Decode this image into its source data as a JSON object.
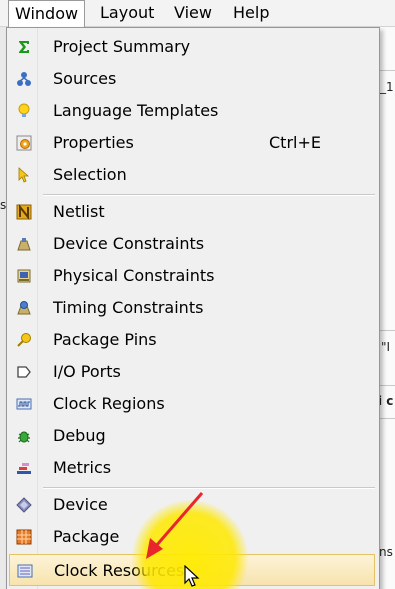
{
  "menubar": {
    "items": [
      {
        "label": "Window",
        "active": true
      },
      {
        "label": "Layout"
      },
      {
        "label": "View"
      },
      {
        "label": "Help"
      }
    ]
  },
  "background": {
    "frag1": "_1",
    "frag2": "s",
    "frag3": "\"I",
    "frag4": "i c",
    "frag5": "ns"
  },
  "menu": {
    "items": [
      {
        "label": "Project Summary",
        "icon": "sigma-icon"
      },
      {
        "label": "Sources",
        "icon": "sources-icon"
      },
      {
        "label": "Language Templates",
        "icon": "lightbulb-icon"
      },
      {
        "label": "Properties",
        "icon": "properties-icon",
        "shortcut": "Ctrl+E"
      },
      {
        "label": "Selection",
        "icon": "selection-cursor-icon"
      },
      {
        "label": "Netlist",
        "icon": "netlist-icon"
      },
      {
        "label": "Device Constraints",
        "icon": "device-constraints-icon"
      },
      {
        "label": "Physical Constraints",
        "icon": "physical-constraints-icon"
      },
      {
        "label": "Timing Constraints",
        "icon": "timing-constraints-icon"
      },
      {
        "label": "Package Pins",
        "icon": "package-pins-icon"
      },
      {
        "label": "I/O Ports",
        "icon": "io-ports-icon"
      },
      {
        "label": "Clock Regions",
        "icon": "clock-regions-icon"
      },
      {
        "label": "Debug",
        "icon": "debug-bug-icon"
      },
      {
        "label": "Metrics",
        "icon": "metrics-icon"
      },
      {
        "label": "Device",
        "icon": "device-icon"
      },
      {
        "label": "Package",
        "icon": "package-icon"
      },
      {
        "label": "Clock Resources",
        "icon": "clock-resources-icon",
        "highlighted": true
      }
    ]
  },
  "colors": {
    "highlight_fill": "#f7e3ad",
    "highlight_border": "#e5c365",
    "annotation_arrow": "#e8262b",
    "cursor_spot": "#ffe800"
  }
}
